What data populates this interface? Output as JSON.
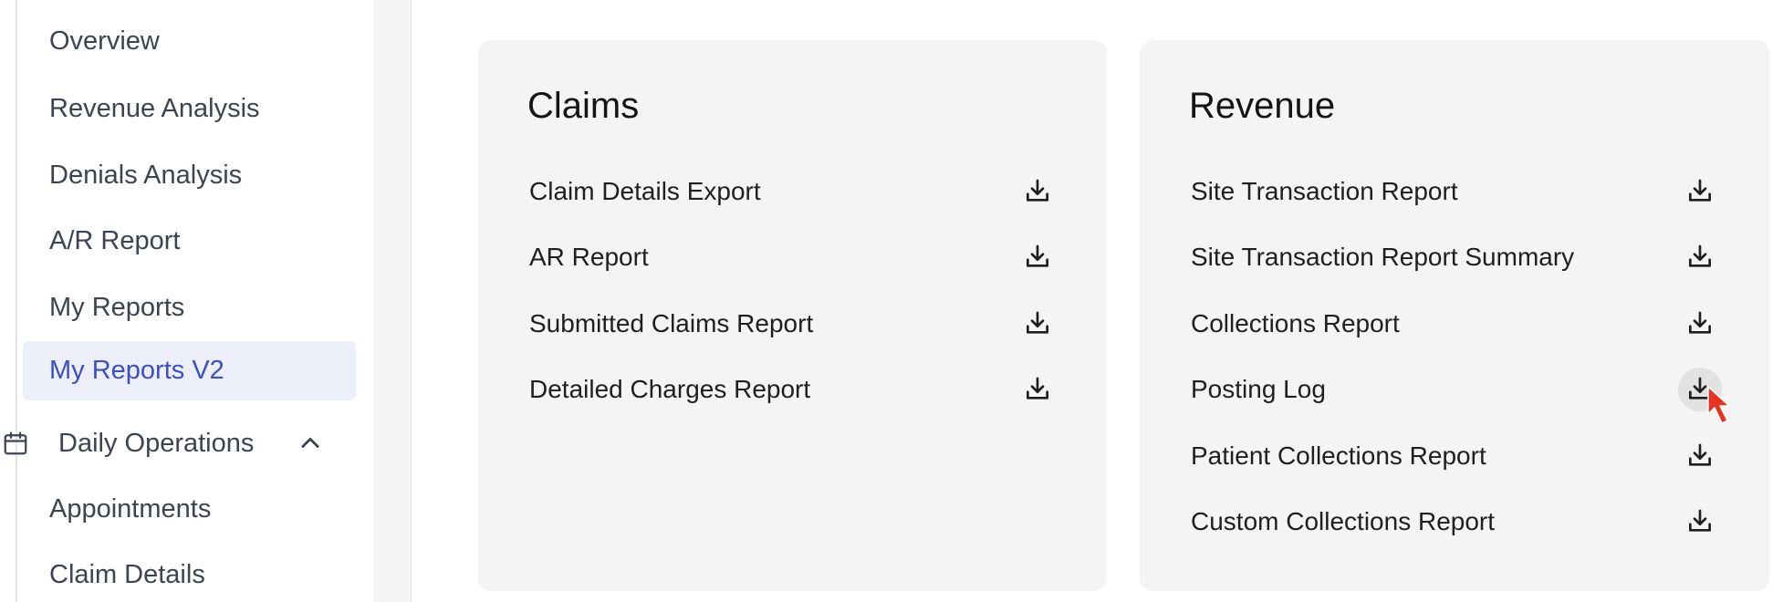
{
  "sidebar": {
    "items": [
      {
        "label": "Overview"
      },
      {
        "label": "Revenue Analysis"
      },
      {
        "label": "Denials Analysis"
      },
      {
        "label": "A/R Report"
      },
      {
        "label": "My Reports"
      },
      {
        "label": "My Reports V2",
        "active": true
      }
    ],
    "section": {
      "label": "Daily Operations",
      "icon": "calendar-icon",
      "expanded": true,
      "items": [
        {
          "label": "Appointments"
        },
        {
          "label": "Claim Details"
        }
      ]
    }
  },
  "cards": {
    "claims": {
      "title": "Claims",
      "reports": [
        {
          "label": "Claim Details Export"
        },
        {
          "label": "AR Report"
        },
        {
          "label": "Submitted Claims Report"
        },
        {
          "label": "Detailed Charges Report"
        }
      ]
    },
    "revenue": {
      "title": "Revenue",
      "reports": [
        {
          "label": "Site Transaction Report"
        },
        {
          "label": "Site Transaction Report Summary"
        },
        {
          "label": "Collections Report"
        },
        {
          "label": "Posting Log",
          "hovered": true
        },
        {
          "label": "Patient Collections Report"
        },
        {
          "label": "Custom Collections Report"
        }
      ]
    }
  },
  "icons": {
    "download": "download-icon",
    "cursor": "mouse-cursor-icon"
  },
  "colors": {
    "active_bg": "#eceefa",
    "active_text": "#3d4fc4",
    "card_bg": "#f4f4f4",
    "cursor": "#e8311f"
  }
}
